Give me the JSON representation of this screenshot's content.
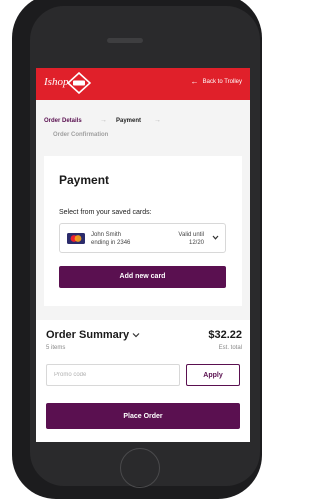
{
  "header": {
    "logo_text": "Ishop",
    "back_link": "Back to Trolley",
    "colors": {
      "header_bg": "#e0202a",
      "accent": "#5a1050"
    },
    "icons": {
      "logo": "shop-logo-icon",
      "back": "arrow-left-icon"
    }
  },
  "breadcrumb": {
    "steps": [
      "Order Details",
      "Payment",
      "Order Confirmation"
    ],
    "separator": "→"
  },
  "payment": {
    "title": "Payment",
    "saved_cards_label": "Select from your saved cards:",
    "saved_card": {
      "holder": "John Smith",
      "ending": "ending in 2346",
      "valid_label": "Valid until",
      "valid_date": "12/20",
      "icon": "mastercard-icon"
    },
    "add_card_label": "Add new card"
  },
  "summary": {
    "title": "Order Summary",
    "items": "5 items",
    "total": "$32.22",
    "total_note": "Est. total",
    "promo_placeholder": "Promo code",
    "apply_label": "Apply",
    "place_order_label": "Place Order"
  }
}
